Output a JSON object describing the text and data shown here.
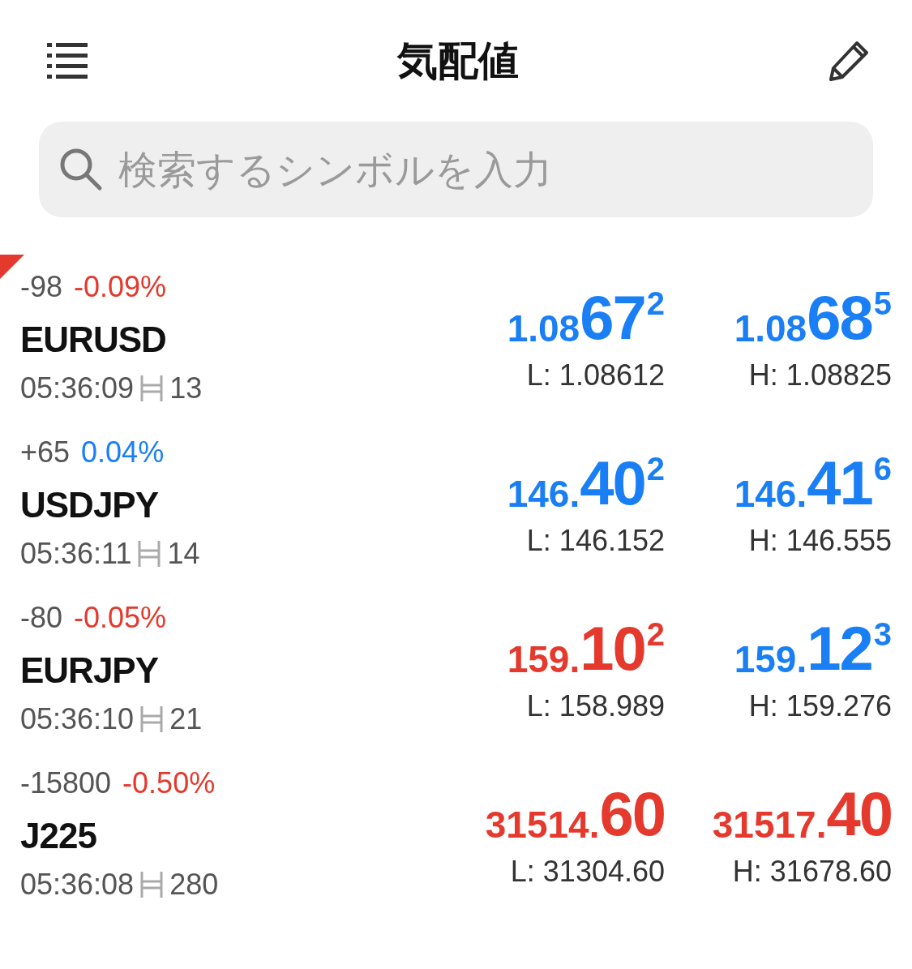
{
  "header": {
    "title": "気配値"
  },
  "search": {
    "placeholder": "検索するシンボルを入力"
  },
  "quotes": [
    {
      "marked": true,
      "change": "-98",
      "percent": "-0.09%",
      "color": "#e5392d",
      "symbol": "EURUSD",
      "time": "05:36:09",
      "spread": "13",
      "bid": {
        "prefix": "1.08",
        "big": "67",
        "sup": "2",
        "color": "#1a7ff5"
      },
      "ask": {
        "prefix": "1.08",
        "big": "68",
        "sup": "5",
        "color": "#1a7ff5"
      },
      "low": "L: 1.08612",
      "high": "H: 1.08825"
    },
    {
      "marked": false,
      "change": "+65",
      "percent": "0.04%",
      "color": "#1a7ff5",
      "symbol": "USDJPY",
      "time": "05:36:11",
      "spread": "14",
      "bid": {
        "prefix": "146.",
        "big": "40",
        "sup": "2",
        "color": "#1a7ff5"
      },
      "ask": {
        "prefix": "146.",
        "big": "41",
        "sup": "6",
        "color": "#1a7ff5"
      },
      "low": "L: 146.152",
      "high": "H: 146.555"
    },
    {
      "marked": false,
      "change": "-80",
      "percent": "-0.05%",
      "color": "#e5392d",
      "symbol": "EURJPY",
      "time": "05:36:10",
      "spread": "21",
      "bid": {
        "prefix": "159.",
        "big": "10",
        "sup": "2",
        "color": "#e5392d"
      },
      "ask": {
        "prefix": "159.",
        "big": "12",
        "sup": "3",
        "color": "#1a7ff5"
      },
      "low": "L: 158.989",
      "high": "H: 159.276"
    },
    {
      "marked": false,
      "change": "-15800",
      "percent": "-0.50%",
      "color": "#e5392d",
      "symbol": "J225",
      "time": "05:36:08",
      "spread": "280",
      "bid": {
        "prefix": "31514.",
        "big": "60",
        "color": "#e5392d"
      },
      "ask": {
        "prefix": "31517.",
        "big": "40",
        "color": "#e5392d"
      },
      "low": "L: 31304.60",
      "high": "H: 31678.60"
    }
  ]
}
